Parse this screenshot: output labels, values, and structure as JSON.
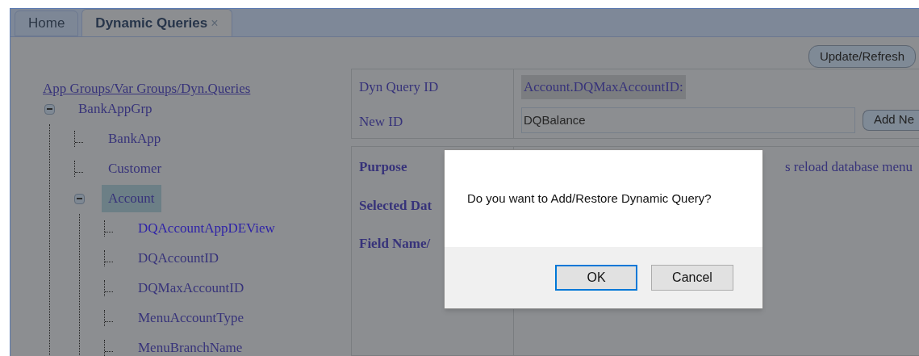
{
  "tabs": [
    {
      "label": "Home",
      "selected": false,
      "closable": false
    },
    {
      "label": "Dynamic Queries",
      "selected": true,
      "closable": true
    }
  ],
  "close_glyph": "×",
  "refresh_button": "Update/Refresh",
  "tree": {
    "root_link": "App Groups/Var Groups/Dyn.Queries",
    "items": [
      {
        "label": "BankAppGrp",
        "selected": false,
        "hover": false,
        "expanded": true,
        "children": [
          {
            "label": "BankApp",
            "selected": false,
            "hover": false,
            "expanded": false
          },
          {
            "label": "Customer",
            "selected": false,
            "hover": false,
            "expanded": false
          },
          {
            "label": "Account",
            "selected": true,
            "hover": false,
            "expanded": true,
            "children": [
              {
                "label": "DQAccountAppDEView",
                "selected": false,
                "hover": true,
                "expanded": false
              },
              {
                "label": "DQAccountID",
                "selected": false,
                "hover": false,
                "expanded": false
              },
              {
                "label": "DQMaxAccountID",
                "selected": false,
                "hover": false,
                "expanded": false
              },
              {
                "label": "MenuAccountType",
                "selected": false,
                "hover": false,
                "expanded": false
              },
              {
                "label": "MenuBranchName",
                "selected": false,
                "hover": false,
                "expanded": false
              }
            ]
          }
        ]
      }
    ]
  },
  "query_form": {
    "id_label": "Dyn Query ID",
    "id_value": "Account.DQMaxAccountID:",
    "new_id_label": "New ID",
    "new_id_value": "DQBalance",
    "add_button": "Add Ne"
  },
  "details": {
    "labels": [
      "Purpose",
      "Selected Dat",
      "Field Name/"
    ],
    "purpose_text": "s reload database menu"
  },
  "dialog": {
    "message": "Do you want to Add/Restore Dynamic Query?",
    "buttons": [
      {
        "label": "OK",
        "focused": true
      },
      {
        "label": "Cancel",
        "focused": false
      }
    ]
  }
}
